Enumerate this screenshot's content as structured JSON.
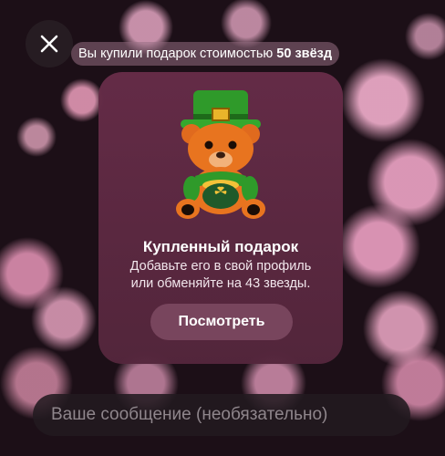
{
  "header": {
    "close_icon": "close-icon"
  },
  "toast": {
    "text_prefix": "Вы купили подарок стоимостью",
    "amount": "50 звёзд"
  },
  "gift_card": {
    "title": "Купленный подарок",
    "description_line1": "Добавьте его в свой профиль",
    "description_line2": "или обменяйте на 43 звезды.",
    "view_button": "Посмотреть",
    "gift_icon": "leprechaun-teddy-bear-icon"
  },
  "composer": {
    "placeholder": "Ваше сообщение (необязательно)"
  },
  "colors": {
    "card_bg": "#62294a",
    "button_bg": "#8a5670",
    "input_bg": "#221a20"
  }
}
